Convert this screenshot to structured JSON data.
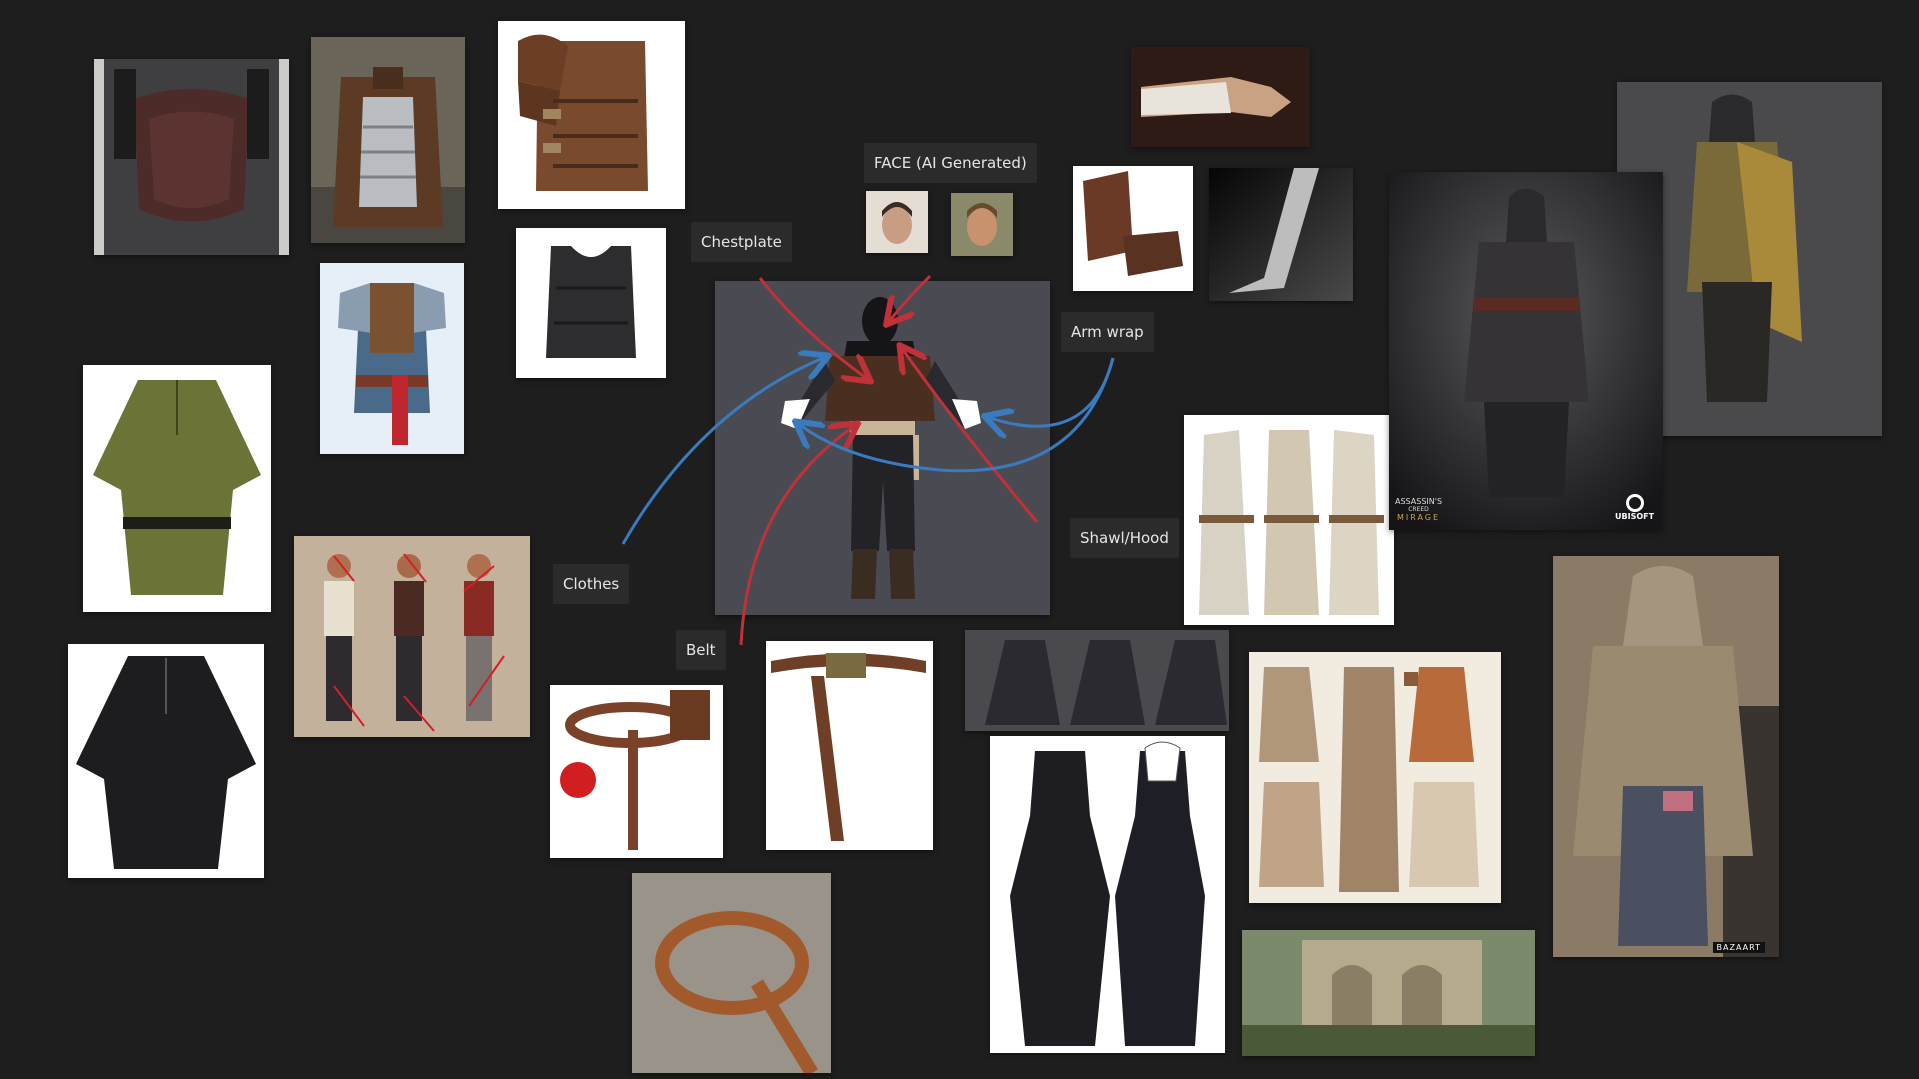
{
  "labels": {
    "face": "FACE (AI Generated)",
    "chestplate": "Chestplate",
    "arm_wrap": "Arm wrap",
    "shawl_hood": "Shawl/Hood",
    "clothes": "Clothes",
    "belt": "Belt"
  },
  "watermarks": {
    "ubisoft": "UBISOFT",
    "ac_line1": "ASSASSIN'S",
    "ac_line2": "CREED",
    "ac_line3": "MIRAGE",
    "bazaart": "BAZAART"
  },
  "colors": {
    "canvas_bg": "#1e1e1e",
    "label_bg": "#2b2b2b",
    "label_text": "#e6e6e6",
    "arrow_red": "#c0313a",
    "arrow_blue": "#3a7bbf"
  },
  "icons": {
    "arrow": "curved-arrow",
    "reference": "reference-image"
  }
}
